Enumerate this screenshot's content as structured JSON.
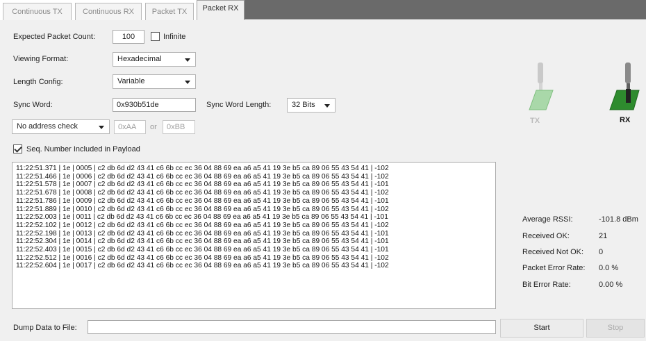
{
  "tabs": [
    {
      "label": "Continuous TX",
      "active": false
    },
    {
      "label": "Continuous RX",
      "active": false
    },
    {
      "label": "Packet TX",
      "active": false
    },
    {
      "label": "Packet RX",
      "active": true
    }
  ],
  "form": {
    "expected_count_label": "Expected Packet Count:",
    "expected_count_value": "100",
    "infinite_label": "Infinite",
    "infinite_checked": false,
    "viewing_format_label": "Viewing Format:",
    "viewing_format_value": "Hexadecimal",
    "length_config_label": "Length Config:",
    "length_config_value": "Variable",
    "sync_word_label": "Sync Word:",
    "sync_word_value": "0x930b51de",
    "sync_word_length_label": "Sync Word Length:",
    "sync_word_length_value": "32 Bits",
    "address_check_value": "No address check",
    "address1_placeholder": "0xAA",
    "or_label": "or",
    "address2_placeholder": "0xBB",
    "seq_number_label": "Seq. Number Included in Payload",
    "seq_number_checked": true
  },
  "log_lines": [
    "11:22:51.371 | 1e | 0005 | c2 db 6d d2 43 41 c6 6b cc ec 36 04 88 69 ea a6 a5 41 19 3e b5 ca 89 06 55 43 54 41  | -102",
    "11:22:51.466 | 1e | 0006 | c2 db 6d d2 43 41 c6 6b cc ec 36 04 88 69 ea a6 a5 41 19 3e b5 ca 89 06 55 43 54 41  | -102",
    "11:22:51.578 | 1e | 0007 | c2 db 6d d2 43 41 c6 6b cc ec 36 04 88 69 ea a6 a5 41 19 3e b5 ca 89 06 55 43 54 41  | -101",
    "11:22:51.678 | 1e | 0008 | c2 db 6d d2 43 41 c6 6b cc ec 36 04 88 69 ea a6 a5 41 19 3e b5 ca 89 06 55 43 54 41  | -102",
    "11:22:51.786 | 1e | 0009 | c2 db 6d d2 43 41 c6 6b cc ec 36 04 88 69 ea a6 a5 41 19 3e b5 ca 89 06 55 43 54 41  | -101",
    "11:22:51.889 | 1e | 0010 | c2 db 6d d2 43 41 c6 6b cc ec 36 04 88 69 ea a6 a5 41 19 3e b5 ca 89 06 55 43 54 41  | -102",
    "11:22:52.003 | 1e | 0011 | c2 db 6d d2 43 41 c6 6b cc ec 36 04 88 69 ea a6 a5 41 19 3e b5 ca 89 06 55 43 54 41  | -101",
    "11:22:52.102 | 1e | 0012 | c2 db 6d d2 43 41 c6 6b cc ec 36 04 88 69 ea a6 a5 41 19 3e b5 ca 89 06 55 43 54 41  | -102",
    "11:22:52.198 | 1e | 0013 | c2 db 6d d2 43 41 c6 6b cc ec 36 04 88 69 ea a6 a5 41 19 3e b5 ca 89 06 55 43 54 41  | -101",
    "11:22:52.304 | 1e | 0014 | c2 db 6d d2 43 41 c6 6b cc ec 36 04 88 69 ea a6 a5 41 19 3e b5 ca 89 06 55 43 54 41  | -101",
    "11:22:52.403 | 1e | 0015 | c2 db 6d d2 43 41 c6 6b cc ec 36 04 88 69 ea a6 a5 41 19 3e b5 ca 89 06 55 43 54 41  | -101",
    "11:22:52.512 | 1e | 0016 | c2 db 6d d2 43 41 c6 6b cc ec 36 04 88 69 ea a6 a5 41 19 3e b5 ca 89 06 55 43 54 41  | -102",
    "11:22:52.604 | 1e | 0017 | c2 db 6d d2 43 41 c6 6b cc ec 36 04 88 69 ea a6 a5 41 19 3e b5 ca 89 06 55 43 54 41  | -102"
  ],
  "stats": {
    "avg_rssi_label": "Average RSSI:",
    "avg_rssi_value": "-101.8 dBm",
    "received_ok_label": "Received OK:",
    "received_ok_value": "21",
    "received_not_ok_label": "Received Not OK:",
    "received_not_ok_value": "0",
    "per_label": "Packet Error Rate:",
    "per_value": "0.0 %",
    "ber_label": "Bit Error Rate:",
    "ber_value": "0.00 %"
  },
  "indicators": {
    "tx_label": "TX",
    "rx_label": "RX",
    "tx_color": "#a9d8a9",
    "rx_color": "#2e8b2e"
  },
  "footer": {
    "dump_label": "Dump Data to File:",
    "dump_value": "",
    "start_label": "Start",
    "stop_label": "Stop"
  }
}
